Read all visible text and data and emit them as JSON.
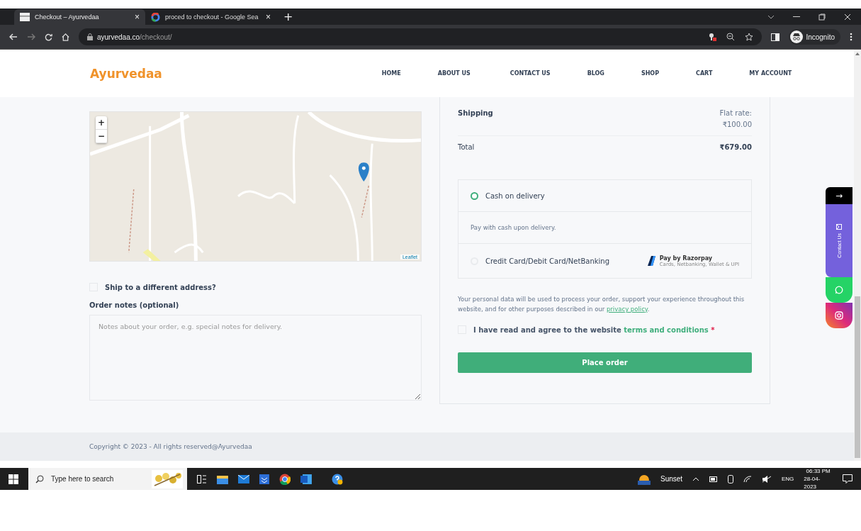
{
  "browser": {
    "tabs": [
      {
        "title": "Checkout – Ayurvedaa",
        "selected": true,
        "close": "×"
      },
      {
        "title": "proced to checkout - Google Sea",
        "selected": false,
        "close": "×"
      }
    ],
    "new_tab": "+",
    "url_host": "ayurvedaa.co",
    "url_path": "/checkout/",
    "profile": "Incognito"
  },
  "site_header": {
    "logo": "Ayurvedaa",
    "nav": [
      "HOME",
      "ABOUT US",
      "CONTACT US",
      "BLOG",
      "SHOP",
      "CART",
      "MY ACCOUNT"
    ]
  },
  "map": {
    "kind": "picture",
    "zoom_in": "+",
    "zoom_out": "−",
    "attribution": "Leaflet"
  },
  "ship_to_different": {
    "label": "Ship to a different address?",
    "checked": false
  },
  "order_notes": {
    "label": "Order notes (optional)",
    "placeholder": "Notes about your order, e.g. special notes for delivery."
  },
  "summary": [
    {
      "label": "Shipping",
      "value_lines": [
        "Flat rate:",
        "₹100.00"
      ],
      "kind": "shipping"
    },
    {
      "label": "Total",
      "value_lines": [
        "₹679.00"
      ],
      "kind": "total"
    }
  ],
  "payment_methods": [
    {
      "label": "Cash on delivery",
      "selected": true,
      "description": "Pay with cash upon delivery."
    },
    {
      "label": "Credit Card/Debit Card/NetBanking",
      "selected": false,
      "badge_title": "Pay by Razorpay",
      "badge_subtitle": "Cards, Netbanking, Wallet & UPI"
    }
  ],
  "privacy": {
    "text": "Your personal data will be used to process your order, support your experience throughout this website, and for other purposes described in our ",
    "link": "privacy policy",
    "end": "."
  },
  "terms": {
    "checked": false,
    "text": "I have read and agree to the website ",
    "link": "terms and conditions",
    "required": "*"
  },
  "place_order": "Place order",
  "floating": {
    "arrow": "→",
    "contact": "Contact Us"
  },
  "footer": "Copyright © 2023 - All rights reserved@Ayurvedaa",
  "taskbar": {
    "search_placeholder": "Type here to search",
    "weather": "Sunset",
    "language": "ENG",
    "time": "06:33 PM",
    "date": "28-04-2023"
  }
}
